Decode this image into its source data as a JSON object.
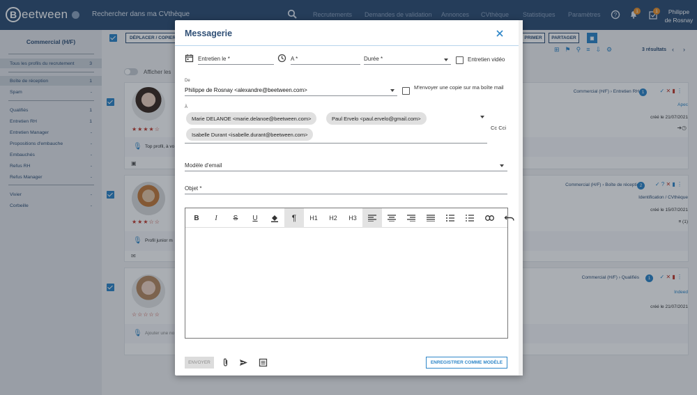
{
  "brand": {
    "name": "eetween",
    "initial": "B"
  },
  "topnav": {
    "search_label": "Rechercher dans ma CVthèque",
    "links": [
      "Recrutements",
      "Demandes de validation",
      "Annonces",
      "CVthèque",
      "Statistiques",
      "Paramètres"
    ],
    "notif_count": "1",
    "tasks_count": "1",
    "user_first": "Philippe",
    "user_last": "de Rosnay"
  },
  "sidebar": {
    "title": "Commercial (H/F)",
    "items": [
      {
        "label": "Tous les profils du recrutement",
        "count": "3"
      },
      {
        "label": "Boîte de réception",
        "count": "1"
      },
      {
        "label": "Spam",
        "count": "-"
      },
      {
        "label": "Qualifiés",
        "count": "1"
      },
      {
        "label": "Entretien RH",
        "count": "1"
      },
      {
        "label": "Entretien Manager",
        "count": "-"
      },
      {
        "label": "Propositions d'embauche",
        "count": "-"
      },
      {
        "label": "Embauchés",
        "count": "-"
      },
      {
        "label": "Refus RH",
        "count": "-"
      },
      {
        "label": "Refus Manager",
        "count": "-"
      },
      {
        "label": "Vivier",
        "count": "-"
      },
      {
        "label": "Corbeille",
        "count": "-"
      }
    ]
  },
  "main": {
    "move_copy": "DÉPLACER / COPIER",
    "print": "PRIMER",
    "share": "PARTAGER",
    "results": "3 résultats",
    "show_label": "Afficher les",
    "cards": [
      {
        "stage": "Commercial (H/F)",
        "step": "Entretien RH",
        "badge": "1",
        "source": "Apec",
        "created": "créé le 21/07/2021",
        "note": "Top profil, à vo"
      },
      {
        "stage": "Commercial (H/F)",
        "step": "Boîte de réception",
        "badge": "2",
        "source": "Identification / CVthèque",
        "created": "créé le 15/07/2021",
        "note": "Profil junior m",
        "count": "(1)"
      },
      {
        "stage": "Commercial (H/F)",
        "step": "Qualifiés",
        "badge": "1",
        "source": "Indeed",
        "created": "créé le 21/07/2021",
        "note": "Ajouter une no"
      }
    ]
  },
  "modal": {
    "title": "Messagerie",
    "interview_date": "Entretien le *",
    "to_time": "A *",
    "duration": "Durée *",
    "video_label": "Entretien vidéo",
    "from_label": "De",
    "from_value": "Philippe de Rosnay <alexandre@beetween.com>",
    "copy_label": "M'envoyer une copie sur ma boîte mail",
    "to_label": "À",
    "recipients": [
      "Marie DELANOE <marie.delanoe@beetween.com>",
      "Paul Ervelo <paul.ervelo@gmail.com>",
      "Isabelle Durant <isabelle.durant@beetween.com>"
    ],
    "cc_label": "Cc Cci",
    "template_label": "Modèle d'email",
    "subject_label": "Objet *",
    "toolbar": [
      "B",
      "I",
      "S",
      "U",
      "fill",
      "¶",
      "H1",
      "H2",
      "H3",
      "align-left",
      "align-center",
      "align-right",
      "justify",
      "bullets",
      "numbers",
      "link"
    ],
    "send_label": "ENVOYER",
    "save_label": "ENREGISTRER COMME MODÈLE"
  }
}
